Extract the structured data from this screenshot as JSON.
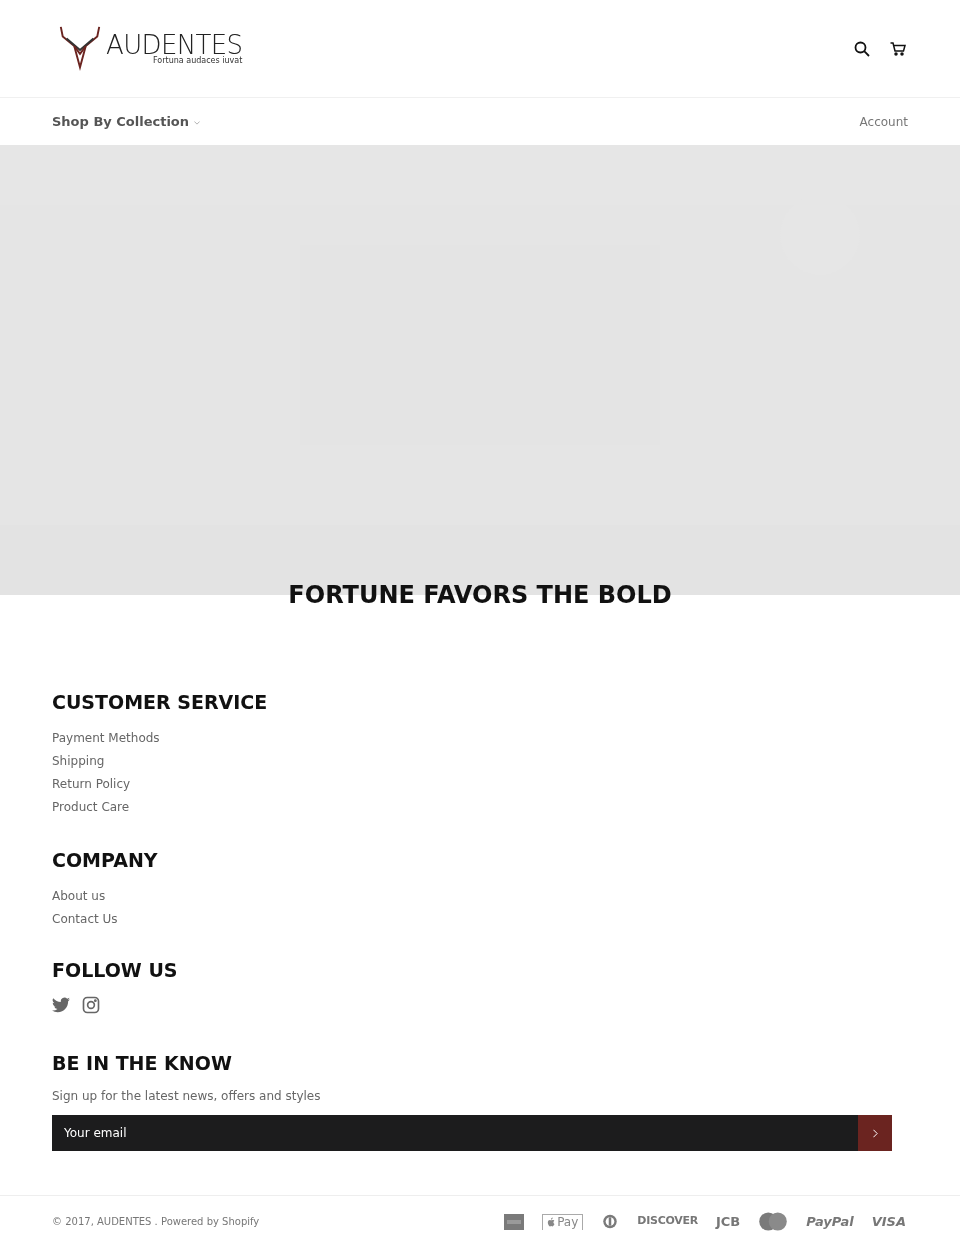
{
  "header": {
    "brand": "AUDENTES",
    "tagline": "Fortuna audaces iuvat"
  },
  "nav": {
    "menu": {
      "label": "Shop By Collection",
      "expanded": false
    },
    "account": "Account"
  },
  "hero": {
    "kind": "picture",
    "heading": "FORTUNE FAVORS THE BOLD"
  },
  "footer": {
    "sections": [
      {
        "title": "CUSTOMER SERVICE",
        "links": [
          "Payment Methods",
          "Shipping",
          "Return Policy",
          "Product Care"
        ]
      },
      {
        "title": "COMPANY",
        "links": [
          "About us",
          "Contact Us"
        ]
      }
    ],
    "follow": {
      "title": "FOLLOW US",
      "networks": [
        {
          "kind": "twitter"
        },
        {
          "kind": "instagram"
        }
      ]
    },
    "newsletter": {
      "title": "BE IN THE KNOW",
      "text": "Sign up for the latest news, offers and styles",
      "placeholder": "Your email"
    },
    "copyright": "© 2017, AUDENTES . Powered by Shopify",
    "payments": [
      {
        "kind": "amex"
      },
      {
        "kind": "applepay",
        "label": "Pay"
      },
      {
        "kind": "diners"
      },
      {
        "kind": "discover",
        "label": "DISCOVER"
      },
      {
        "kind": "jcb",
        "label": "JCB"
      },
      {
        "kind": "mastercard"
      },
      {
        "kind": "paypal",
        "label": "PayPal"
      },
      {
        "kind": "visa",
        "label": "VISA"
      }
    ]
  }
}
